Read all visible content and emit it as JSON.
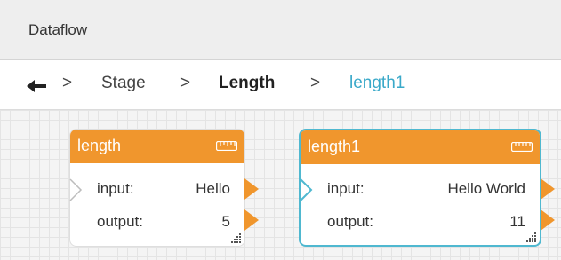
{
  "window": {
    "title": "Dataflow"
  },
  "breadcrumb": {
    "back_icon": "arrow-left-icon",
    "items": [
      {
        "label": "Stage",
        "style": "normal"
      },
      {
        "label": "Length",
        "style": "bold"
      },
      {
        "label": "length1",
        "style": "current"
      }
    ],
    "separator": ">"
  },
  "nodes": [
    {
      "title": "length",
      "header_icon": "ruler-icon",
      "selected": false,
      "input": {
        "label": "input:",
        "value": "Hello"
      },
      "output": {
        "label": "output:",
        "value": "5"
      }
    },
    {
      "title": "length1",
      "header_icon": "ruler-icon",
      "selected": true,
      "input": {
        "label": "input:",
        "value": "Hello World"
      },
      "output": {
        "label": "output:",
        "value": "11"
      }
    }
  ],
  "colors": {
    "node_header": "#f0962d",
    "selection": "#4fb8d0",
    "breadcrumb_current": "#3aa9c9"
  }
}
